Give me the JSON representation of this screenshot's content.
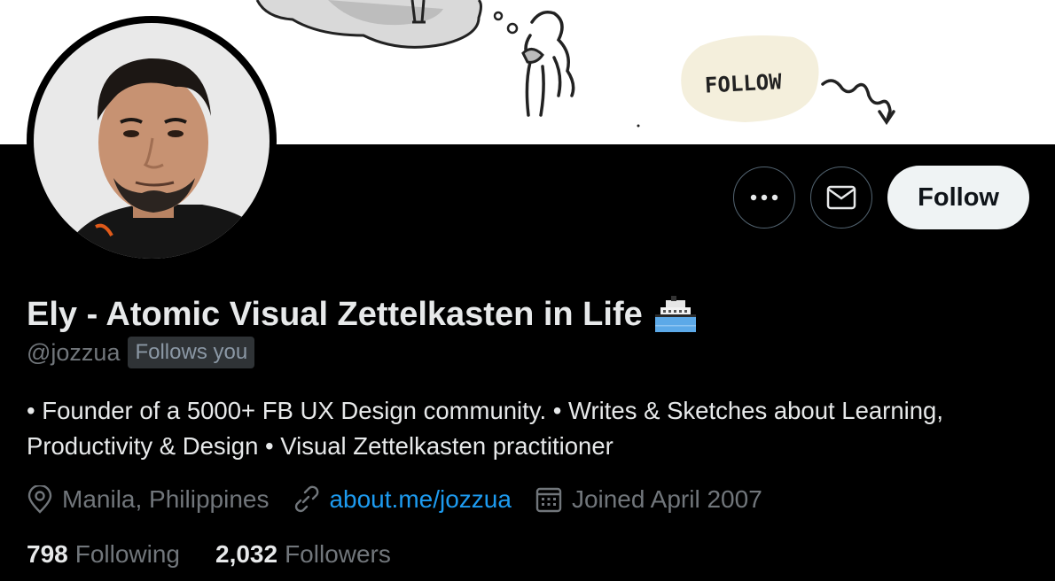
{
  "banner": {
    "sketch_text": "FOLLOW"
  },
  "profile": {
    "display_name": "Ely - Atomic Visual Zettelkasten in Life",
    "name_emoji": "ship-icon",
    "handle": "@jozzua",
    "follows_you_badge": "Follows you",
    "bio": "• Founder of a 5000+ FB UX Design community. • Writes & Sketches about Learning, Productivity & Design • Visual Zettelkasten practitioner",
    "location": "Manila, Philippines",
    "website": "about.me/jozzua",
    "joined": "Joined April 2007"
  },
  "actions": {
    "more_icon": "more-horizontal-icon",
    "message_icon": "envelope-icon",
    "follow_label": "Follow"
  },
  "stats": {
    "following_count": "798",
    "following_label": "Following",
    "followers_count": "2,032",
    "followers_label": "Followers"
  },
  "colors": {
    "background": "#000000",
    "text_primary": "#e7e9ea",
    "text_secondary": "#71767b",
    "link": "#1d9bf0",
    "follow_button_bg": "#eff3f4"
  }
}
